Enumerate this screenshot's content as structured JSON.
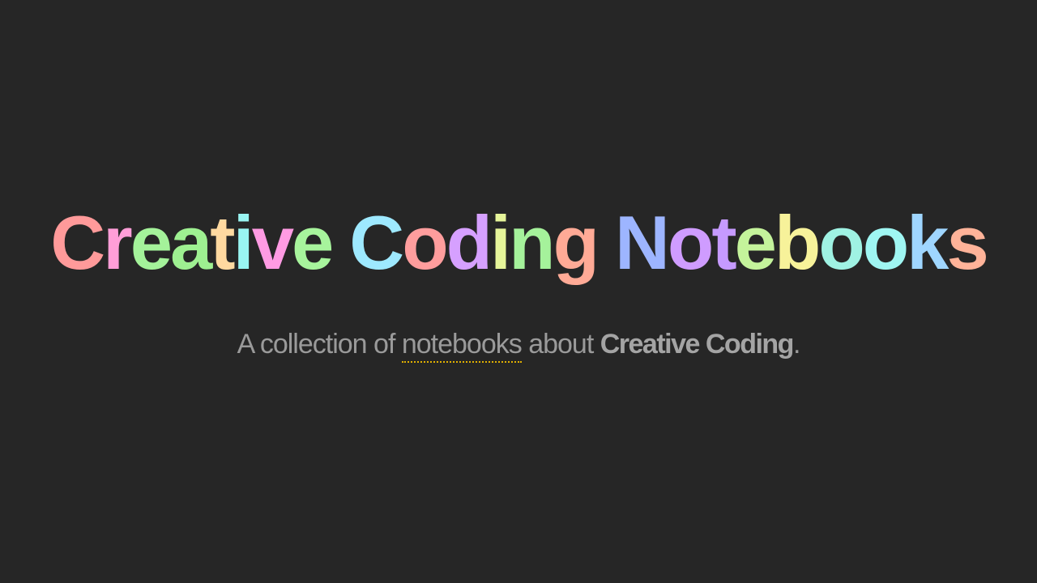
{
  "title": {
    "letters": [
      {
        "char": "C",
        "color": "#ff9a9a"
      },
      {
        "char": "r",
        "color": "#ff9ed8"
      },
      {
        "char": "e",
        "color": "#a4f29a"
      },
      {
        "char": "a",
        "color": "#9ef091"
      },
      {
        "char": "t",
        "color": "#ffd9a0"
      },
      {
        "char": "i",
        "color": "#99f5f2"
      },
      {
        "char": "v",
        "color": "#ff9be3"
      },
      {
        "char": "e",
        "color": "#a7f49c"
      },
      {
        "char": " ",
        "color": ""
      },
      {
        "char": "C",
        "color": "#9ee9ff"
      },
      {
        "char": "o",
        "color": "#ff9d9d"
      },
      {
        "char": "d",
        "color": "#d6a0ff"
      },
      {
        "char": "i",
        "color": "#e6f59a"
      },
      {
        "char": "n",
        "color": "#a5f29b"
      },
      {
        "char": "g",
        "color": "#ffaa96"
      },
      {
        "char": " ",
        "color": ""
      },
      {
        "char": "N",
        "color": "#9db5ff"
      },
      {
        "char": "o",
        "color": "#cf9cff"
      },
      {
        "char": "t",
        "color": "#c69aff"
      },
      {
        "char": "e",
        "color": "#c4f39b"
      },
      {
        "char": "b",
        "color": "#f7f29a"
      },
      {
        "char": "o",
        "color": "#9ff2e3"
      },
      {
        "char": "o",
        "color": "#9ff6f2"
      },
      {
        "char": "k",
        "color": "#9fd6ff"
      },
      {
        "char": "s",
        "color": "#ffb399"
      }
    ]
  },
  "subtitle": {
    "prefix": "A collection of ",
    "link_text": "notebooks",
    "middle": " about ",
    "strong_text": "Creative Coding",
    "suffix": "."
  },
  "colors": {
    "background": "#262626",
    "subtitle_text": "#9a9a9a",
    "link_underline": "#e2b100"
  }
}
